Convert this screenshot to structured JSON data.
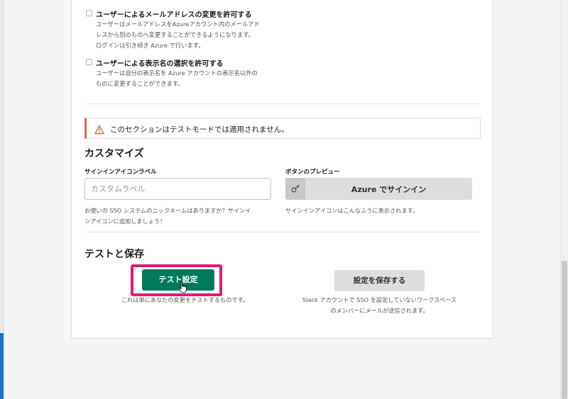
{
  "options": [
    {
      "title": "ユーザーによるメールアドレスの変更を許可する",
      "desc_lines": [
        "ユーザーはメールアドレスをAzureアカウント内のメールアド",
        "レスから別のものへ変更することができるようになります。",
        "ログインは引き続き Azure で行います。"
      ],
      "checked": false
    },
    {
      "title": "ユーザーによる表示名の選択を許可する",
      "desc_lines": [
        "ユーザーは自分の表示名を Azure アカウントの表示名以外の",
        "ものに変更することができます。"
      ],
      "checked": false
    }
  ],
  "warning": {
    "text": "このセクションはテストモードでは適用されません。",
    "icon": "warning-triangle-icon",
    "color": "#e06c54"
  },
  "customize": {
    "heading": "カスタマイズ",
    "signin_label": {
      "label": "サインインアイコンラベル",
      "placeholder": "カスタムラベル",
      "value": "",
      "help_lines": [
        "お使いの SSO システムのニックネームはありますか？サインイ",
        "ンアイコンに追加しましょう！"
      ]
    },
    "preview": {
      "label": "ボタンのプレビュー",
      "button_text": "Azure でサインイン",
      "icon": "key-icon",
      "help": "サインインアイコンはこんなふうに表示されます。"
    }
  },
  "test_save": {
    "heading": "テストと保存",
    "test_button": "テスト設定",
    "test_help": "これは単にあなたの変更をテストするものです。",
    "save_button": "設定を保存する",
    "save_help_lines": [
      "Slack アカウントで SSO を設定していないワークスペース",
      "のメンバーにメールが送信されます。"
    ]
  },
  "colors": {
    "primary": "#007a5a",
    "highlight": "#e0197a",
    "warning": "#e06c54"
  }
}
